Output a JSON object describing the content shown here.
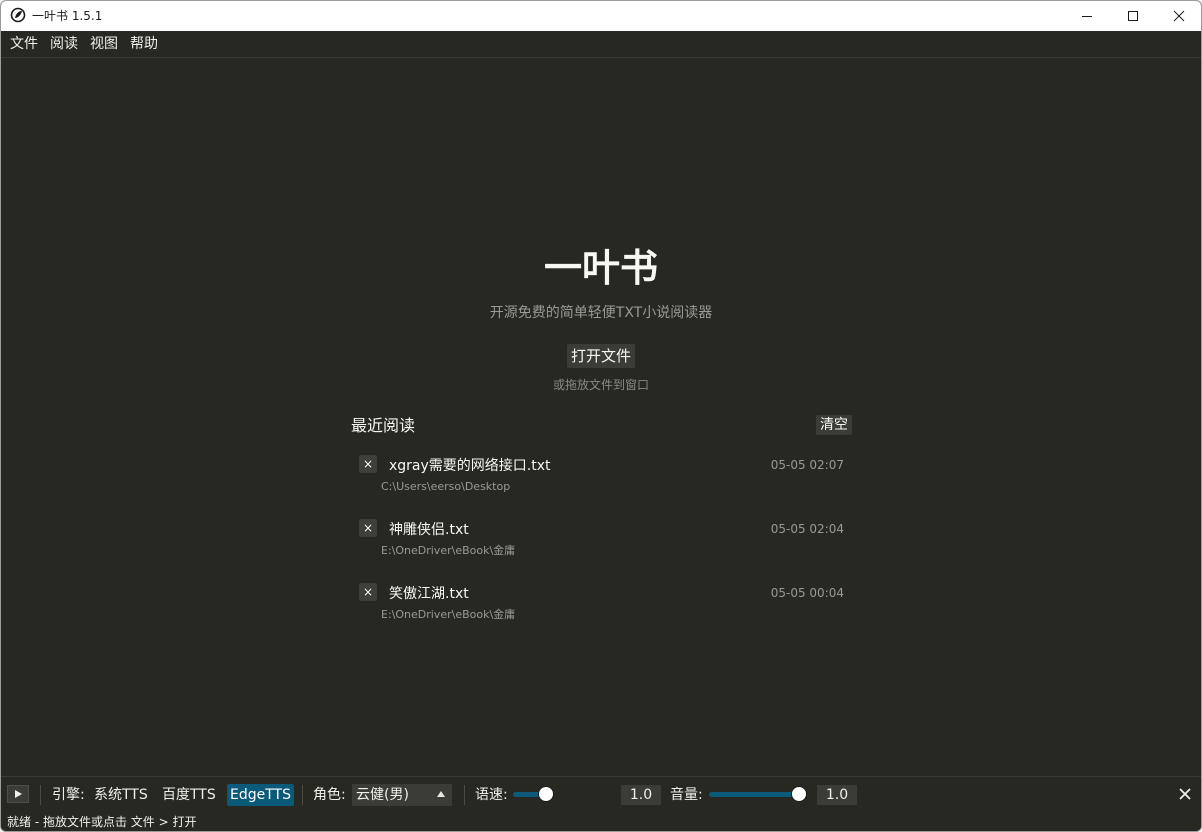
{
  "window": {
    "title": "一叶书 1.5.1",
    "controls": [
      "minimize-icon",
      "maximize-icon",
      "close-icon"
    ]
  },
  "menu": {
    "items": [
      "文件",
      "阅读",
      "视图",
      "帮助"
    ]
  },
  "welcome": {
    "title": "一叶书",
    "subtitle": "开源免费的简单轻便TXT小说阅读器",
    "open_button": "打开文件",
    "drop_hint": "或拖放文件到窗口"
  },
  "recent": {
    "title": "最近阅读",
    "clear_button": "清空",
    "remove_icon": "×",
    "items": [
      {
        "name": "xgray需要的网络接口.txt",
        "path": "C:\\Users\\eerso\\Desktop",
        "time": "05-05 02:07"
      },
      {
        "name": "神雕侠侣.txt",
        "path": "E:\\OneDriver\\eBook\\金庸",
        "time": "05-05 02:04"
      },
      {
        "name": "笑傲江湖.txt",
        "path": "E:\\OneDriver\\eBook\\金庸",
        "time": "05-05 00:04"
      }
    ]
  },
  "tts": {
    "engine_label": "引擎:",
    "engines": [
      "系统TTS",
      "百度TTS",
      "EdgeTTS"
    ],
    "active_engine": "EdgeTTS",
    "voice_label": "角色:",
    "voice_value": "云健(男)",
    "speed_label": "语速:",
    "speed_value": "1.0",
    "speed_fraction": 0.3,
    "volume_label": "音量:",
    "volume_value": "1.0",
    "volume_fraction": 0.98,
    "accent_color": "#0b5a7a"
  },
  "status": {
    "text": "就绪 - 拖放文件或点击 文件 > 打开"
  },
  "colors": {
    "background": "#272822",
    "text": "#f8f8f2",
    "muted": "#9a9a90"
  }
}
